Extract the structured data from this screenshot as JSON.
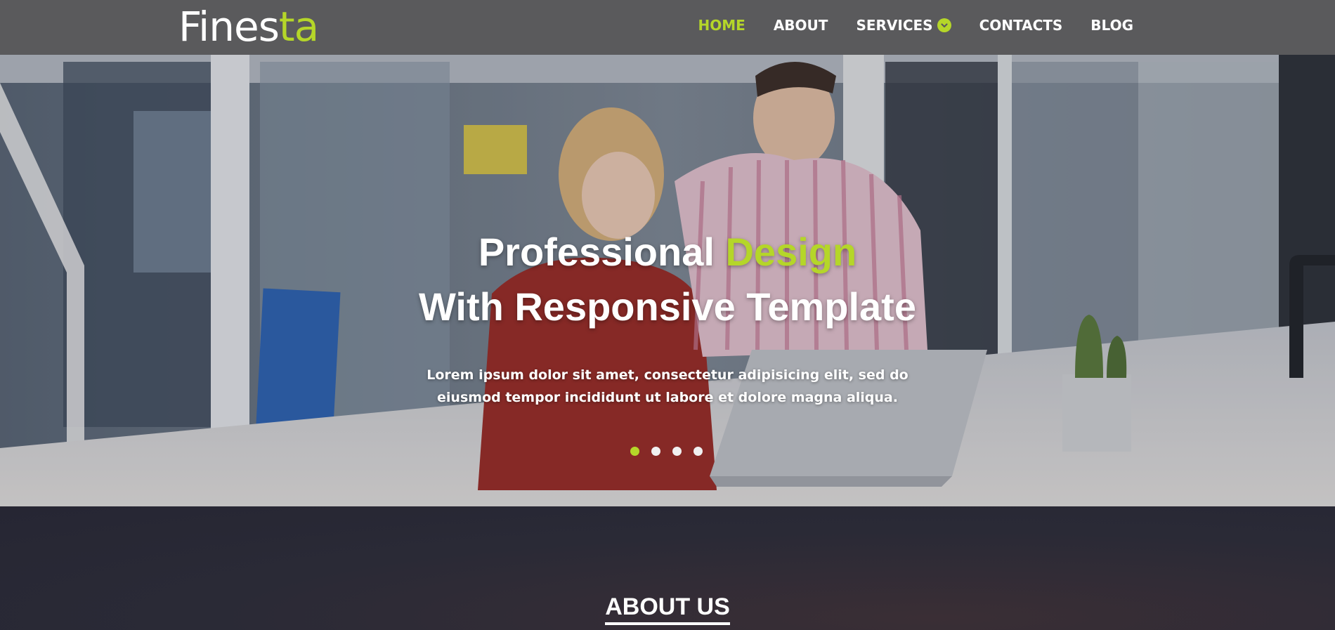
{
  "brand": {
    "logo_main": "Fines",
    "logo_accent": "ta",
    "accent_color": "#b5d629"
  },
  "nav": {
    "items": [
      {
        "label": "HOME",
        "active": true
      },
      {
        "label": "ABOUT"
      },
      {
        "label": "SERVICES",
        "icon": "chevron-down-circle-icon"
      },
      {
        "label": "CONTACTS"
      },
      {
        "label": "BLOG"
      }
    ]
  },
  "hero": {
    "title_line1_part1": "Professional",
    "title_line1_accent": "Design",
    "title_line2": "With Responsive Template",
    "subtitle": "Lorem ipsum dolor sit amet, consectetur adipisicing elit, sed do eiusmod tempor incididunt ut labore et dolore magna aliqua.",
    "slides": 4,
    "active_slide": 1
  },
  "about": {
    "title": "ABOUT US"
  }
}
